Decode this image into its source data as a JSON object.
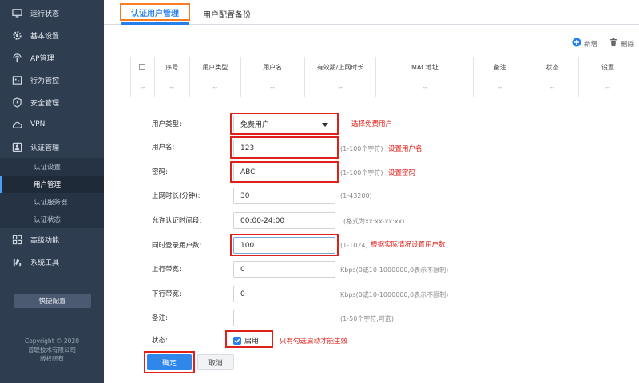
{
  "sidebar": {
    "items": [
      {
        "label": "运行状态",
        "icon": "monitor-icon"
      },
      {
        "label": "基本设置",
        "icon": "gear-icon"
      },
      {
        "label": "AP管理",
        "icon": "wifi-ap-icon"
      },
      {
        "label": "行为管控",
        "icon": "control-icon"
      },
      {
        "label": "安全管理",
        "icon": "shield-icon"
      },
      {
        "label": "VPN",
        "icon": "cloud-icon"
      },
      {
        "label": "认证管理",
        "icon": "user-badge-icon"
      }
    ],
    "sub_items": [
      {
        "label": "认证设置"
      },
      {
        "label": "用户管理"
      },
      {
        "label": "认证服务器"
      },
      {
        "label": "认证状态"
      }
    ],
    "items_after": [
      {
        "label": "高级功能",
        "icon": "grid-icon"
      },
      {
        "label": "系统工具",
        "icon": "tools-icon"
      }
    ],
    "quick_button": "快捷配置",
    "copyright": [
      "Copyright © 2020",
      "普联技术有限公司",
      "版权所有"
    ]
  },
  "tabs": {
    "active": "认证用户管理",
    "other": "用户配置备份"
  },
  "toolbar": {
    "add": "新增",
    "delete": "删除"
  },
  "table": {
    "headers": [
      "序号",
      "用户类型",
      "用户名",
      "有效期/上网时长",
      "MAC地址",
      "备注",
      "状态",
      "设置"
    ],
    "row": [
      "--",
      "--",
      "--",
      "--",
      "--",
      "--",
      "--",
      "--",
      "--"
    ]
  },
  "form": {
    "user_type": {
      "label": "用户类型:",
      "value": "免费用户",
      "note": "选择免费用户"
    },
    "username": {
      "label": "用户名:",
      "value": "123",
      "hint": "(1-100个字符)",
      "note": "设置用户名"
    },
    "password": {
      "label": "密码:",
      "value": "ABC",
      "hint": "(1-100个字符)",
      "note": "设置密码"
    },
    "online_time": {
      "label": "上网时长(分钟):",
      "value": "30",
      "hint": "(1-43200)"
    },
    "allowed_period": {
      "label": "允许认证时间段:",
      "value": "00:00-24:00",
      "hint": "(格式为xx:xx-xx:xx)"
    },
    "concurrent": {
      "label": "同时登录用户数:",
      "value": "100",
      "hint": "(1-1024)",
      "note": "根据实际情况设置用户数"
    },
    "upstream": {
      "label": "上行带宽:",
      "value": "0",
      "hint": "Kbps(0或10-1000000,0表示不限制)"
    },
    "downstream": {
      "label": "下行带宽:",
      "value": "0",
      "hint": "Kbps(0或10-1000000,0表示不限制)"
    },
    "remark": {
      "label": "备注:",
      "value": "",
      "hint": "(1-50个字符,可选)"
    },
    "status": {
      "label": "状态:",
      "checkbox_label": "启用",
      "note": "只有勾选启动才能生效"
    }
  },
  "buttons": {
    "ok": "确定",
    "cancel": "取消"
  },
  "colors": {
    "accent": "#2680eb",
    "annotation": "#e0201a",
    "tab_highlight": "#f57c1f",
    "sidebar_bg": "#2f3d51"
  }
}
